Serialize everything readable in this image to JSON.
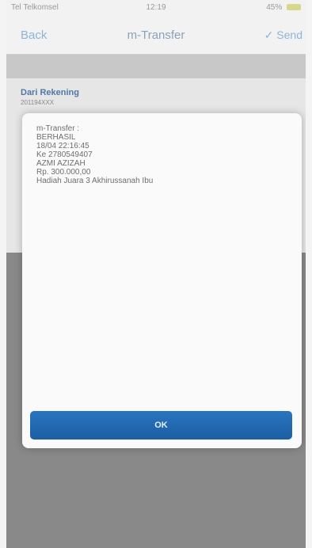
{
  "status_bar": {
    "carrier": "Tel Telkomsel",
    "time": "12:19",
    "right": "45%"
  },
  "nav": {
    "back": "Back",
    "title": "m-Transfer",
    "send": "Send"
  },
  "account": {
    "name": "Dari Rekening",
    "number": "201194XXX"
  },
  "modal": {
    "lines": [
      "m-Transfer :",
      "BERHASIL",
      "18/04 22:16:45",
      "Ke 2780549407",
      "AZMI AZIZAH",
      "Rp. 300.000,00",
      "Hadiah Juara 3 Akhirussanah Ibu"
    ],
    "ok_label": "OK"
  },
  "colors": {
    "accent": "#1f66ad",
    "link": "#8db5d8"
  }
}
